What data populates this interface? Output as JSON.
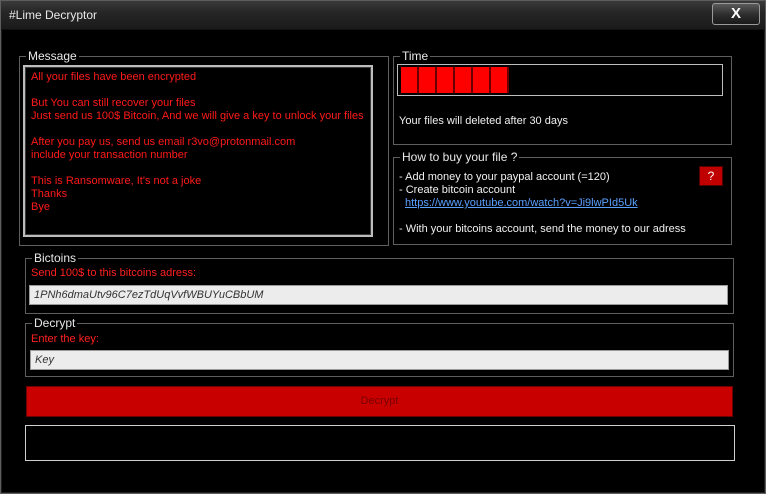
{
  "window": {
    "title": "#Lime Decryptor",
    "close_label": "X"
  },
  "message_group": {
    "legend": "Message",
    "lines": [
      [
        "All your files have been encrypted"
      ],
      [
        "But You can still recover your files",
        "Just send us 100$ Bitcoin, And we will give a key to unlock your files"
      ],
      [
        "After you pay us, send us email r3vo@protonmail.com",
        "include your transaction number"
      ],
      [
        "This is Ransomware, It's not a joke",
        "Thanks",
        "Bye"
      ]
    ]
  },
  "time_group": {
    "legend": "Time",
    "status": "Your files will deleted after 30 days",
    "progress_segments_filled": 6,
    "progress_fraction": 0.38
  },
  "howto_group": {
    "legend": "How to buy your file ?",
    "line1": "- Add money to your paypal account (=120)",
    "line2": "- Create bitcoin account",
    "link": "https://www.youtube.com/watch?v=Ji9lwPId5Uk",
    "line3": "- With your bitcoins account, send the money to our adress",
    "help_button": "?"
  },
  "bitcoins_group": {
    "legend": "Bictoins",
    "instruction": "Send 100$ to this bitcoins adress:",
    "address": "1PNh6dmaUtv96C7ezTdUqVvfWBUYuCBbUM"
  },
  "decrypt_group": {
    "legend": "Decrypt",
    "instruction": "Enter the key:",
    "key_placeholder": "Key",
    "button_label": "Decrypt"
  },
  "colors": {
    "accent_red": "#ff0000",
    "button_red": "#c80000",
    "background": "#000000"
  },
  "icons": {
    "help": "question-mark"
  }
}
